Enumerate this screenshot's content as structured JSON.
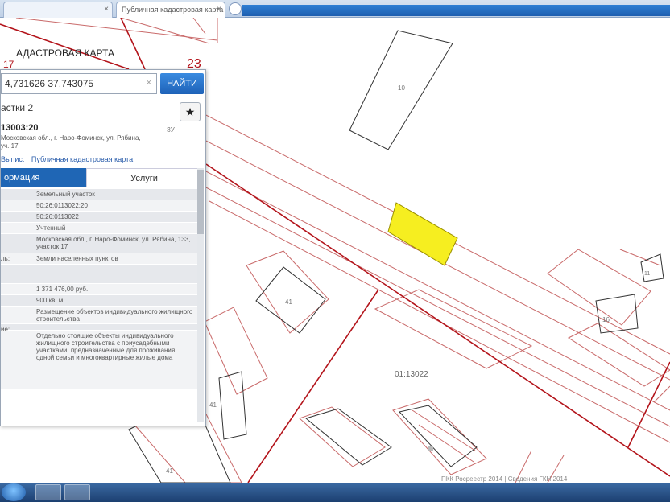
{
  "browser": {
    "tabs": [
      {
        "label": ""
      },
      {
        "label": "Публичная кадастровая карта"
      }
    ]
  },
  "map": {
    "header": "АДАСТРОВАЯ КАРТА",
    "plot_numbers": {
      "top_left": "17",
      "top_red": "23"
    },
    "building_labels": [
      "10",
      "41",
      "16",
      "41",
      "41",
      "01:13022",
      "11"
    ],
    "footer": "ПКК Росреестр 2014 | Сведения ГКН 2014"
  },
  "panel": {
    "search_value": "4,731626 37,743075",
    "search_clear": "×",
    "find_label": "НАЙТИ",
    "title": "астки 2",
    "star": "★",
    "number": "13003:20",
    "address": "Московская обл., г. Наро-Фоминск, ул. Рябина,",
    "address2": "уч. 17",
    "side_note": "ЗУ",
    "links": [
      "Выпис.",
      "Публичная кадастровая карта"
    ],
    "tab_info": "ормация",
    "tab_services": "Услуги",
    "rows": [
      {
        "label": "",
        "value": "Земельный участок",
        "h": 14
      },
      {
        "label": "",
        "value": "50:26:0113022:20",
        "h": 14
      },
      {
        "label": "",
        "value": "50:26:0113022",
        "h": 14
      },
      {
        "label": "",
        "value": "Учтенный",
        "h": 14
      },
      {
        "label": "",
        "value": "Московская обл., г. Наро-Фоминск, ул. Рябина, 133, участок 17",
        "h": 24
      },
      {
        "label": "ль:",
        "value": "Земли населенных пунктов",
        "h": 14
      },
      {
        "label": "",
        "value": "",
        "h": 24
      },
      {
        "label": "",
        "value": "1 371 476,00 руб.",
        "h": 14
      },
      {
        "label": "",
        "value": "900 кв. м",
        "h": 14
      },
      {
        "label": "",
        "value": "Размещение объектов индивидуального жилищного строительства",
        "h": 22
      },
      {
        "label": "ие:",
        "value": "",
        "h": 8
      },
      {
        "label": "",
        "value": "Отдельно стоящие объекты индивидуального жилищного строительства с приусадебными участками, предназначенные для проживания одной семьи и многоквартирные жилые дома",
        "h": 74
      }
    ]
  }
}
